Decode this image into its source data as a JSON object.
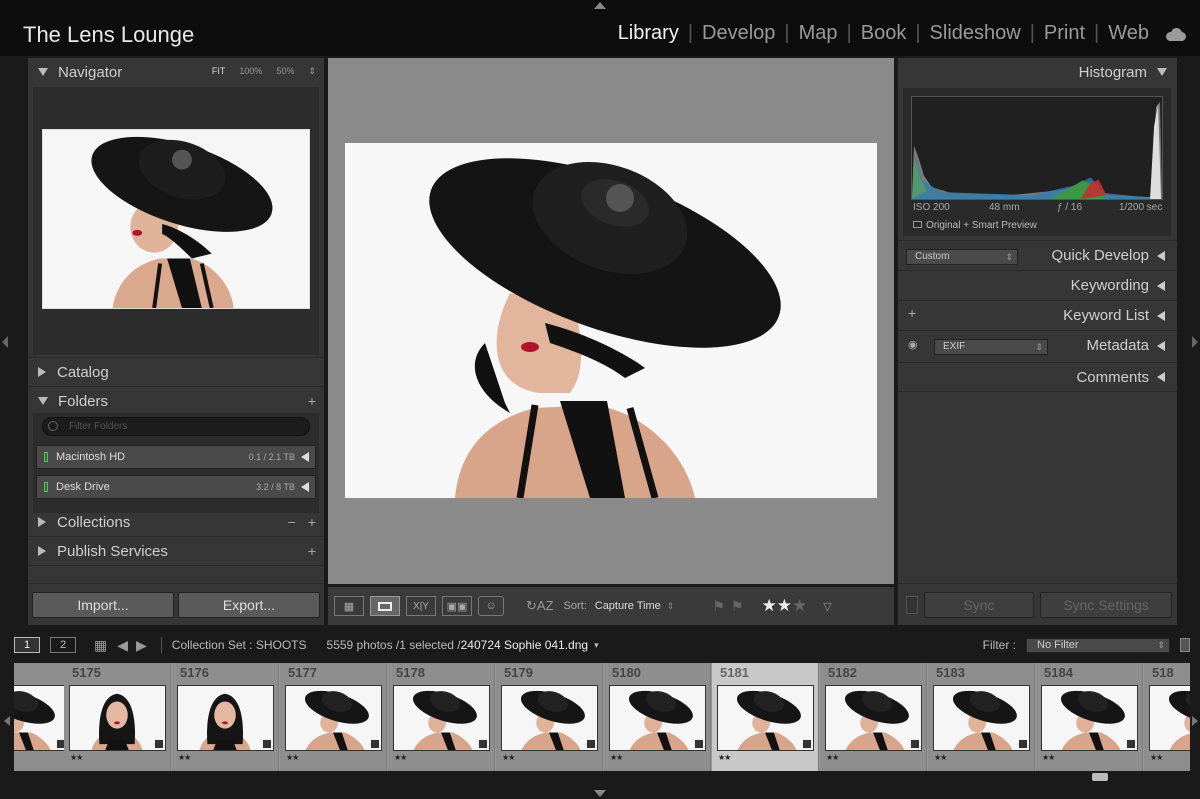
{
  "app": {
    "title": "The Lens Lounge"
  },
  "modules": [
    "Library",
    "Develop",
    "Map",
    "Book",
    "Slideshow",
    "Print",
    "Web"
  ],
  "active_module": "Library",
  "left": {
    "navigator": {
      "label": "Navigator",
      "zoom": [
        "FIT",
        "100%",
        "50%"
      ]
    },
    "catalog": "Catalog",
    "folders": {
      "label": "Folders",
      "filter_placeholder": "Filter Folders",
      "drives": [
        {
          "name": "Macintosh HD",
          "size": "0.1 / 2.1 TB"
        },
        {
          "name": "Desk Drive",
          "size": "3.2 / 8 TB"
        }
      ]
    },
    "collections": "Collections",
    "publish": "Publish Services",
    "import": "Import...",
    "export": "Export..."
  },
  "right": {
    "histogram": "Histogram",
    "exif": {
      "iso": "ISO 200",
      "focal": "48 mm",
      "aperture": "ƒ / 16",
      "shutter": "1/200 sec"
    },
    "preview_status": "Original + Smart Preview",
    "quick_develop": {
      "label": "Quick Develop",
      "preset": "Custom"
    },
    "keywording": "Keywording",
    "keyword_list": "Keyword List",
    "metadata": {
      "label": "Metadata",
      "preset": "EXIF"
    },
    "comments": "Comments",
    "sync": "Sync",
    "sync_settings": "Sync Settings"
  },
  "toolbar": {
    "sort_label": "Sort:",
    "sort_value": "Capture Time",
    "rating": 2
  },
  "filmbar": {
    "pages": [
      "1",
      "2"
    ],
    "source": "Collection Set : SHOOTS",
    "count": "5559 photos /1 selected /",
    "filename": "240724 Sophie 041.dng",
    "filter_label": "Filter :",
    "filter_value": "No Filter"
  },
  "filmstrip": [
    {
      "num": "",
      "stars": "★★",
      "kind": "hat"
    },
    {
      "num": "5175",
      "stars": "★★",
      "kind": "hair"
    },
    {
      "num": "5176",
      "stars": "★★",
      "kind": "hair"
    },
    {
      "num": "5177",
      "stars": "★★",
      "kind": "hat"
    },
    {
      "num": "5178",
      "stars": "★★",
      "kind": "hat"
    },
    {
      "num": "5179",
      "stars": "★★",
      "kind": "hat"
    },
    {
      "num": "5180",
      "stars": "★★",
      "kind": "hat"
    },
    {
      "num": "5181",
      "stars": "★★",
      "kind": "hat",
      "selected": true
    },
    {
      "num": "5182",
      "stars": "★★",
      "kind": "hat"
    },
    {
      "num": "5183",
      "stars": "★★",
      "kind": "hat"
    },
    {
      "num": "5184",
      "stars": "★★",
      "kind": "hat"
    },
    {
      "num": "518",
      "stars": "★★",
      "kind": "hat"
    }
  ]
}
